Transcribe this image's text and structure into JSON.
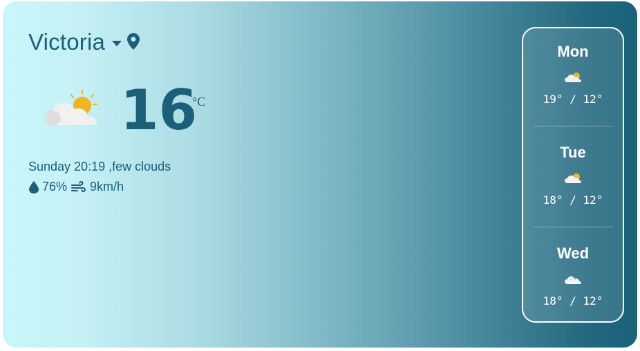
{
  "location": {
    "city": "Victoria"
  },
  "current": {
    "temperature": "16",
    "unit": "°C",
    "day_time": "Sunday 20:19",
    "condition": " ,few clouds",
    "humidity": "76%",
    "wind": "9km/h",
    "icon": "few-clouds-icon"
  },
  "forecast": [
    {
      "day": "Mon",
      "high": "19°",
      "low": "12°",
      "icon": "few-clouds-icon"
    },
    {
      "day": "Tue",
      "high": "18°",
      "low": "12°",
      "icon": "few-clouds-icon"
    },
    {
      "day": "Wed",
      "high": "18°",
      "low": "12°",
      "icon": "cloud-icon"
    }
  ],
  "colors": {
    "primary_text": "#1b6078",
    "gradient_start": "#c9f6fb",
    "gradient_end": "#19627a",
    "forecast_border": "#ffffff"
  }
}
